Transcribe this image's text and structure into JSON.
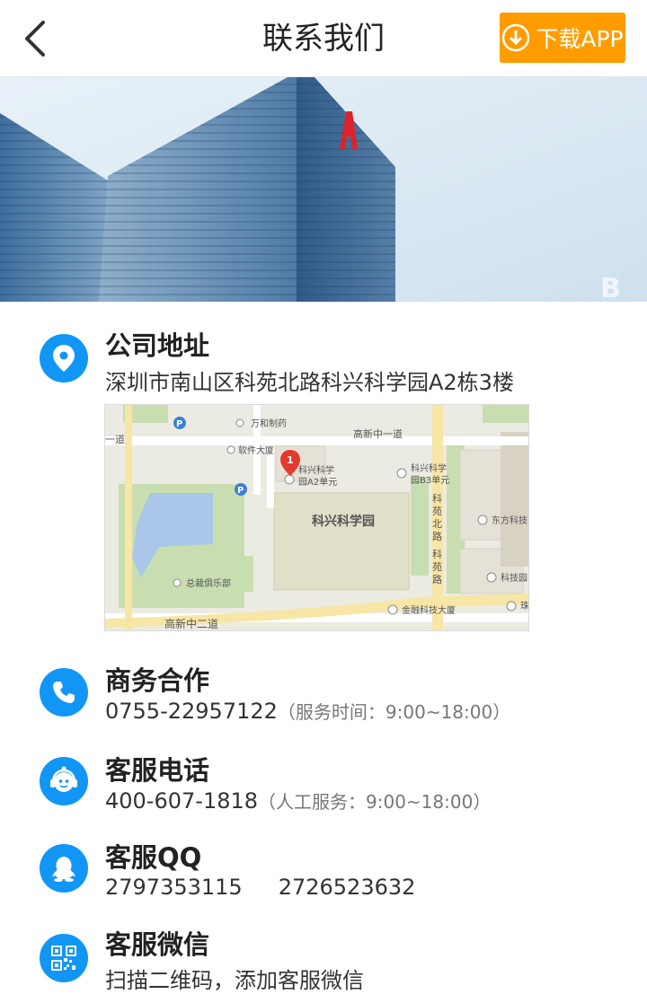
{
  "header": {
    "title": "联系我们",
    "download_label": "下载APP"
  },
  "address": {
    "title": "公司地址",
    "text": "深圳市南山区科苑北路科兴科学园A2栋3楼"
  },
  "map": {
    "labels": {
      "road_top": "高新中一道",
      "road_bottom": "高新中二道",
      "road_left": "一道",
      "road_kykb": "科苑北路",
      "road_ky": "科苑路",
      "park": "科兴科学园",
      "pin_number": "1",
      "pin_label_1": "科兴科学",
      "pin_label_2": "园A2单元",
      "b3_label_1": "科兴科学",
      "b3_label_2": "园B3单元",
      "wanhe": "万和制药",
      "software": "软件大厦",
      "club": "总裁俱乐部",
      "finance": "金融科技大厦",
      "dongfang": "东方科技",
      "kejiyuan": "科技园",
      "zhu": "珠",
      "parking": "P"
    }
  },
  "business": {
    "title": "商务合作",
    "phone": "0755-22957122",
    "note": "（服务时间：9:00~18:00）"
  },
  "service_phone": {
    "title": "客服电话",
    "phone": "400-607-1818",
    "note": "（人工服务：9:00~18:00）"
  },
  "service_qq": {
    "title": "客服QQ",
    "qq1": "2797353115",
    "qq2": "2726523632"
  },
  "service_wechat": {
    "title": "客服微信",
    "text": "扫描二维码，添加客服微信"
  },
  "colors": {
    "accent": "#1196f5",
    "download": "#ff9c00"
  },
  "icons": {
    "back": "chevron-left-icon",
    "download": "download-icon",
    "address": "location-pin-icon",
    "business": "phone-icon",
    "service_phone": "customer-service-icon",
    "service_qq": "qq-icon",
    "service_wechat": "qrcode-icon"
  }
}
